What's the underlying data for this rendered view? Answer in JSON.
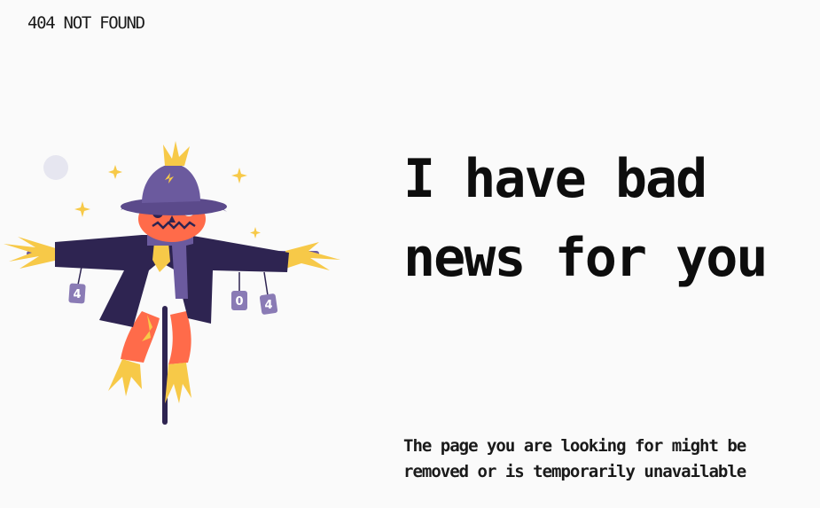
{
  "header": {
    "brand": "404 NOT FOUND"
  },
  "main": {
    "headline": "I have bad news for you",
    "message": "The page you are looking for might be removed or is temporarily unavailable"
  },
  "illustration": {
    "name": "scarecrow-illustration",
    "can_labels": [
      "4",
      "0",
      "4"
    ]
  },
  "colors": {
    "background": "#fafafa",
    "text": "#111111",
    "hat": "#5b4a8b",
    "coat": "#2e2451",
    "face": "#ff6b4a",
    "straw": "#f7c948",
    "scarf": "#6b5a9e",
    "can": "#8a7bb5"
  }
}
